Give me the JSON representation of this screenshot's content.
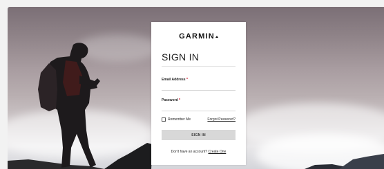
{
  "brand": {
    "name": "GARMIN"
  },
  "form": {
    "title": "SIGN IN",
    "email": {
      "label": "Email Address",
      "required_mark": "*",
      "value": "",
      "placeholder": ""
    },
    "password": {
      "label": "Password",
      "required_mark": "*",
      "value": "",
      "placeholder": ""
    },
    "remember_me": {
      "label": "Remember Me",
      "checked": false
    },
    "forgot_password": "Forgot Password?",
    "submit_label": "SIGN IN",
    "footer": {
      "prompt": "Don't have an account?",
      "link": "Create One"
    }
  },
  "colors": {
    "required": "#d0021b",
    "button_bg": "#d8d8d8",
    "modal_bg": "#ffffff"
  },
  "icons": [
    "garmin-logo-triangle",
    "checkbox"
  ]
}
